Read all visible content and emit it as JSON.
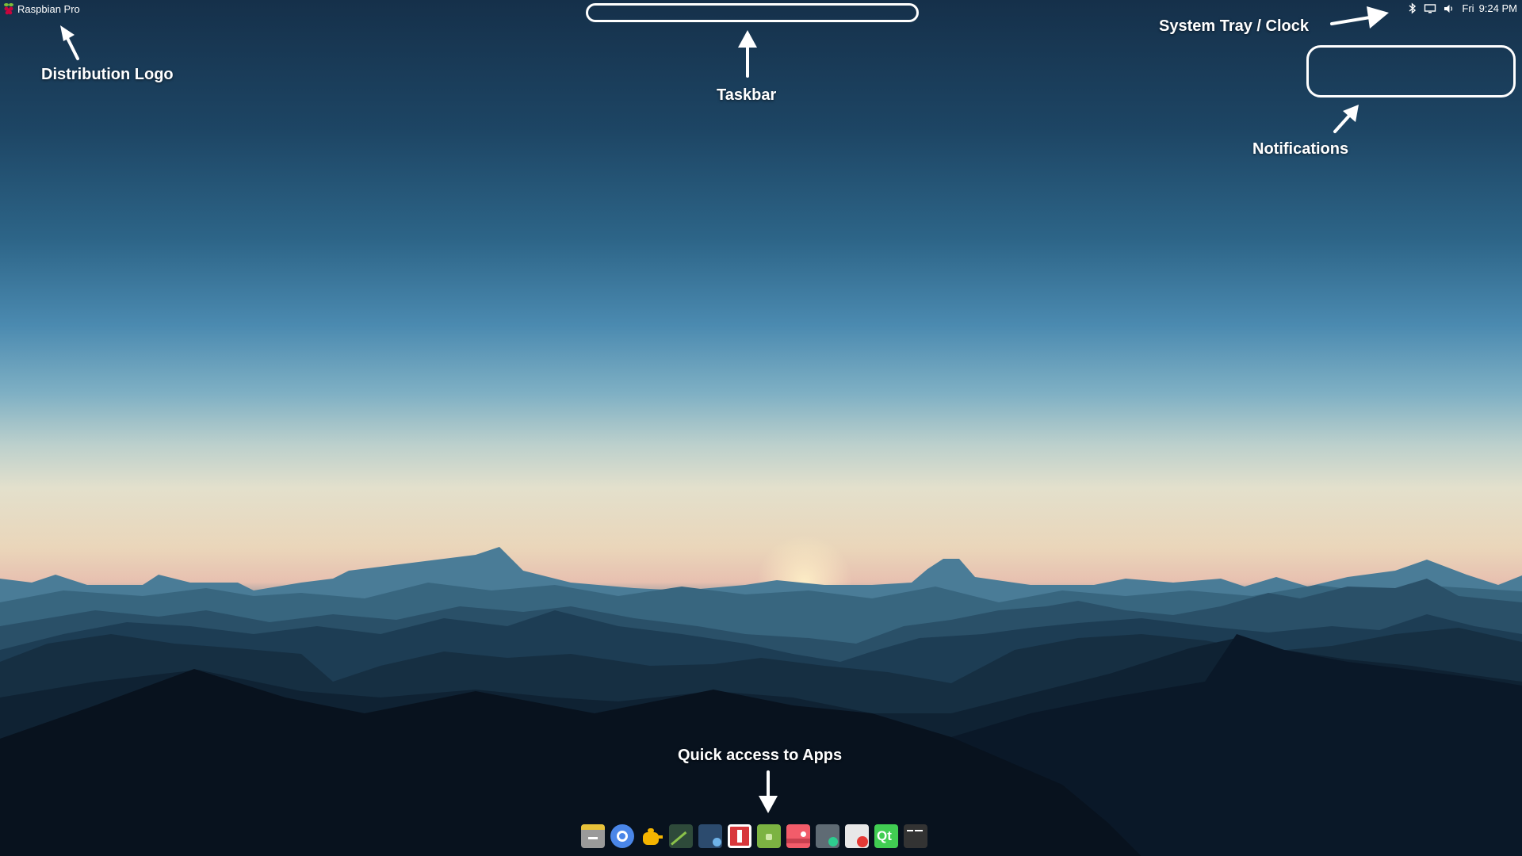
{
  "topbar": {
    "distro_name": "Raspbian Pro",
    "logo_icon": "raspberry-pi-logo-icon",
    "tray": {
      "icons": [
        "bluetooth-icon",
        "display-icon",
        "volume-icon"
      ],
      "day": "Fri",
      "time": "9:24 PM"
    }
  },
  "annotations": {
    "distribution_logo": "Distribution Logo",
    "taskbar": "Taskbar",
    "system_tray": "System Tray / Clock",
    "notifications": "Notifications",
    "quick_access": "Quick access to Apps"
  },
  "dock": {
    "apps": [
      "file-manager-icon",
      "chromium-browser-icon",
      "teapot-app-icon",
      "geany-editor-icon",
      "screenshot-tool-icon",
      "archive-manager-icon",
      "android-app-icon",
      "image-viewer-icon",
      "calculator-icon",
      "text-editor-icon",
      "qt-creator-icon",
      "terminal-icon"
    ]
  },
  "colors": {
    "sky_top": "#15304a",
    "horizon_glow": "#e3e0cc",
    "mountain_dark": "#0b1a2a",
    "annotation_white": "#ffffff"
  }
}
